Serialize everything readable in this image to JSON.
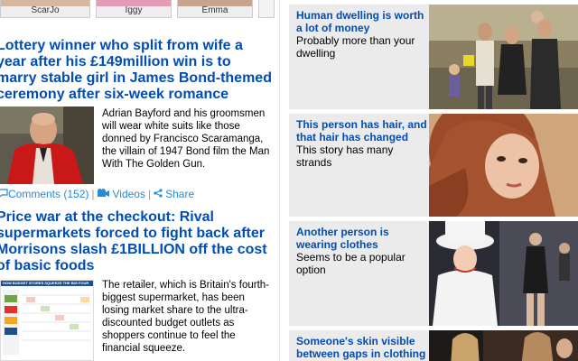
{
  "thumbnails": [
    {
      "caption": "ScarJo"
    },
    {
      "caption": "Iggy"
    },
    {
      "caption": "Emma"
    }
  ],
  "articles": [
    {
      "headline": "Lottery winner who split from wife a year after his £149million win is to marry stable girl in James Bond-themed ceremony after six-week romance",
      "summary": "Adrian Bayford and his groomsmen will wear white suits like those donned by Francisco Scaramanga, the villain of 1947 Bond film the Man With The Golden Gun.",
      "comments_label": "Comments (152)",
      "videos_label": "Videos",
      "share_label": "Share"
    },
    {
      "headline": "Price war at the checkout: Rival supermarkets forced to fight back after Morrisons slash £1BILLION off the cost of basic foods",
      "summary": "The retailer, which is Britain's fourth-biggest supermarket, has been losing market share to the ultra-discounted budget outlets as shoppers continue to feel the financial squeeze.",
      "graphic_text": "HOW BUDGET STORES SQUEEZE THE BIG FOUR"
    }
  ],
  "sidebar": [
    {
      "title": "Human dwelling is worth a lot of money",
      "subtitle": "Probably more than your dwelling"
    },
    {
      "title": "This person has hair, and that hair has changed",
      "subtitle": "This story has many strands"
    },
    {
      "title": "Another person is wearing clothes",
      "subtitle": "Seems to be a popular option"
    },
    {
      "title": "Someone's skin visible between gaps in clothing",
      "subtitle": ""
    }
  ]
}
